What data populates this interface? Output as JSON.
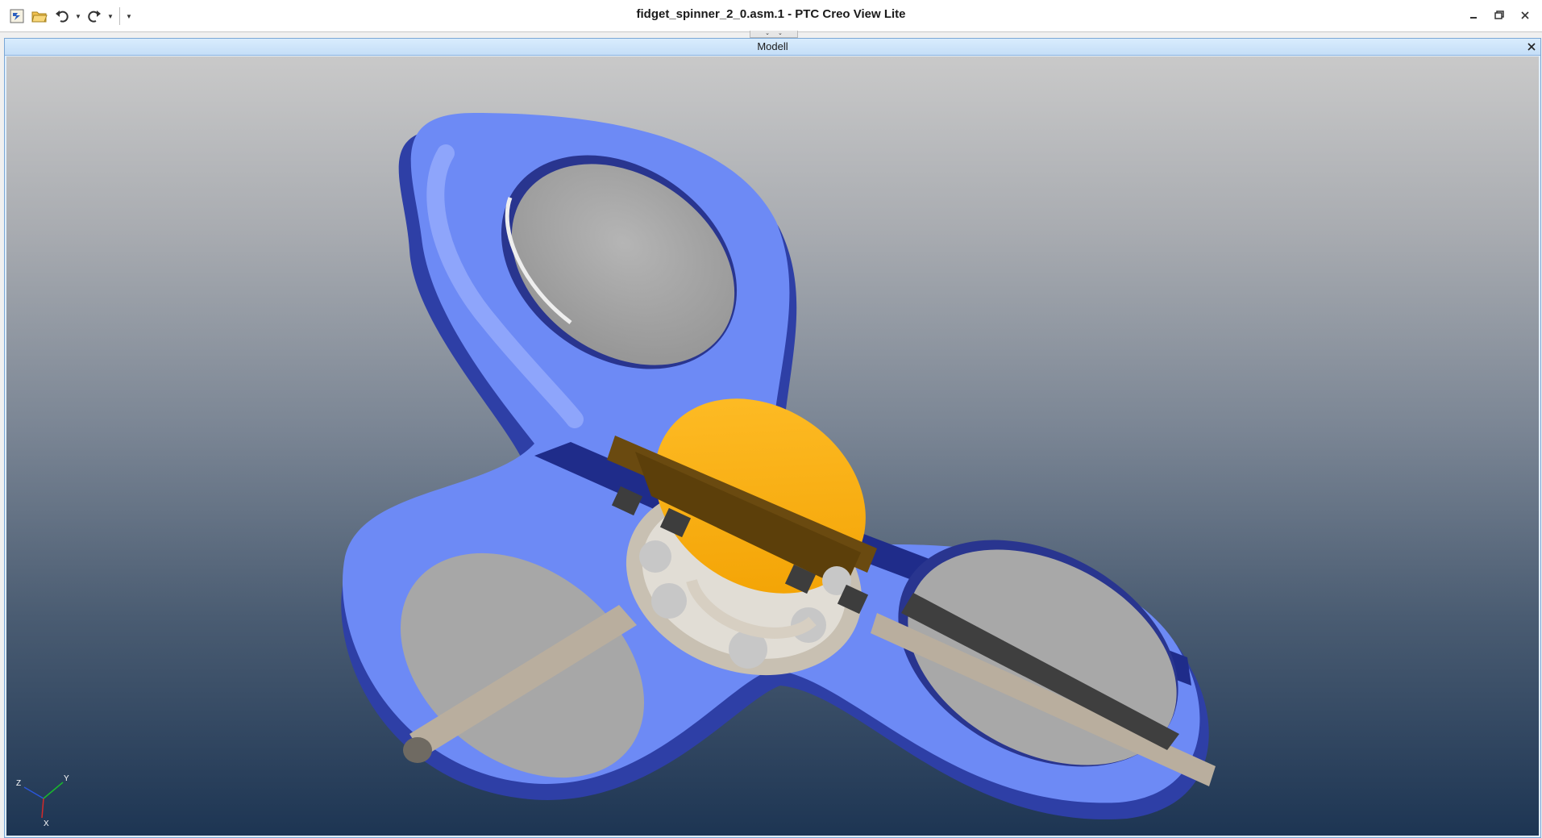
{
  "window": {
    "title": "fidget_spinner_2_0.asm.1 - PTC Creo View Lite"
  },
  "quick_access": {
    "buttons": [
      "app-menu-icon",
      "open-icon",
      "undo-icon",
      "redo-icon",
      "customize-icon"
    ]
  },
  "model_panel": {
    "title": "Modell"
  },
  "triad": {
    "z": "Z",
    "y": "Y",
    "x": "X"
  },
  "colors": {
    "body_blue": "#6d8af5",
    "bearing_orange": "#ffb000",
    "cap_gray": "#a6a6a6",
    "section_tan": "#b9ae9e"
  }
}
